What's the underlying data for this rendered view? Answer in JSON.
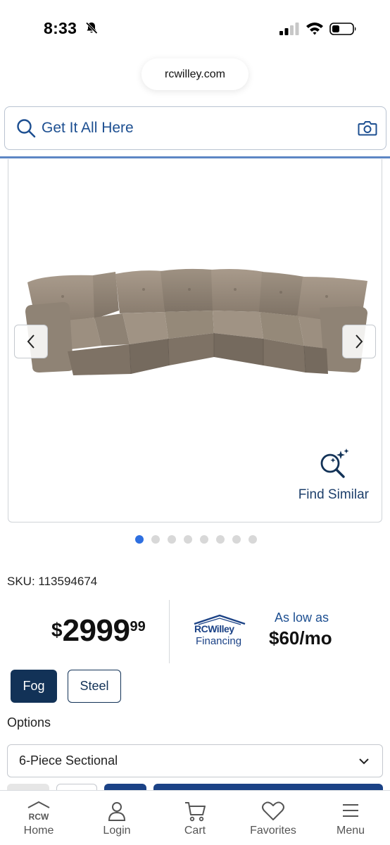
{
  "status_bar": {
    "time": "8:33"
  },
  "browser": {
    "url": "rcwilley.com"
  },
  "search": {
    "placeholder": "Get It All Here"
  },
  "gallery": {
    "find_similar_label": "Find Similar",
    "dot_count": 8,
    "active_dot": 0
  },
  "product": {
    "sku": "SKU: 113594674",
    "price_symbol": "$",
    "price_dollars": "2999",
    "price_cents": "99"
  },
  "financing": {
    "brand": "RCWilley",
    "sub": "Financing",
    "as_low_as": "As low as",
    "monthly": "$60/mo"
  },
  "colors": [
    {
      "label": "Fog",
      "selected": true
    },
    {
      "label": "Steel",
      "selected": false
    }
  ],
  "options": {
    "label": "Options",
    "selected": "6-Piece Sectional"
  },
  "bottom_nav": {
    "home": "Home",
    "home_logo": "RCW",
    "login": "Login",
    "cart": "Cart",
    "favorites": "Favorites",
    "menu": "Menu"
  },
  "theme": {
    "navy": "#123257",
    "link_blue": "#1d4f91",
    "active_dot": "#2e6fe0"
  }
}
